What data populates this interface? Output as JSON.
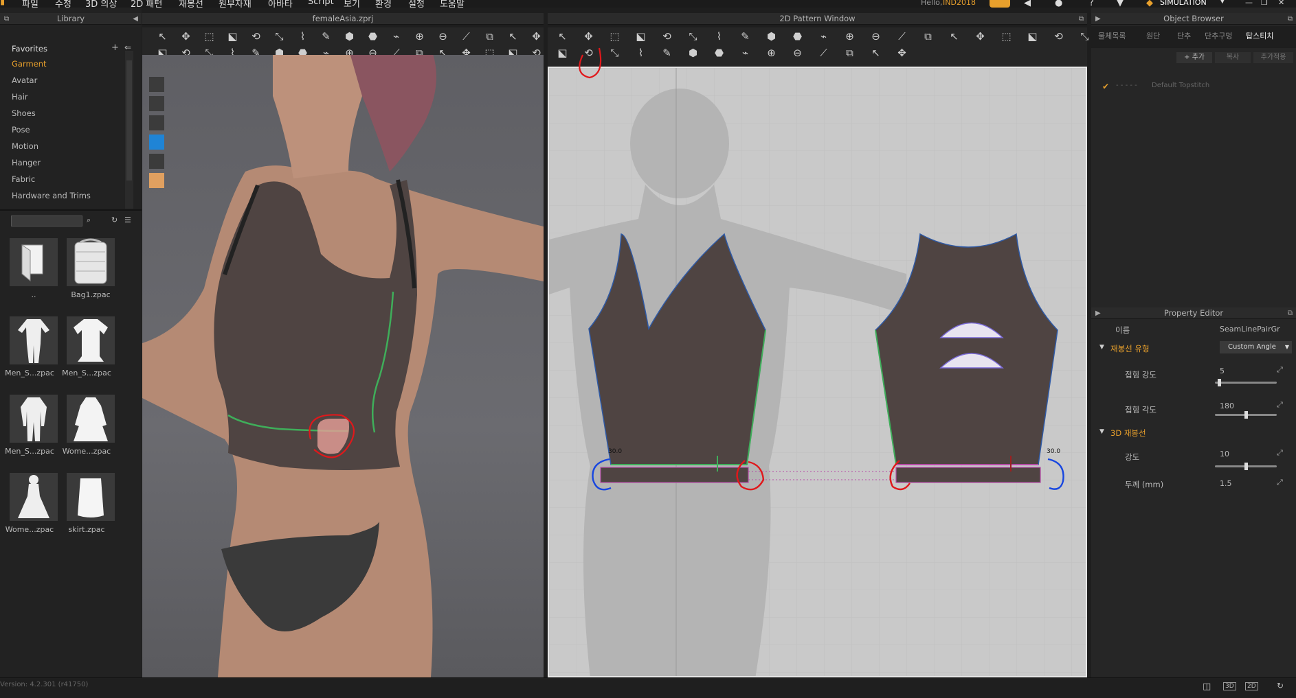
{
  "menu": [
    "파일",
    "수정",
    "3D 의상",
    "2D 패턴",
    "재봉선",
    "원부자재",
    "아바타",
    "Script",
    "보기",
    "환경",
    "설정",
    "도움말"
  ],
  "top_right": {
    "hello": "Hello, ",
    "user": "IND2018",
    "mode": "SIMULATION"
  },
  "library": {
    "title": "Library",
    "favorites_label": "Favorites",
    "items": [
      "Garment",
      "Avatar",
      "Hair",
      "Shoes",
      "Pose",
      "Motion",
      "Hanger",
      "Fabric",
      "Hardware and Trims"
    ],
    "search_placeholder": "",
    "thumbnails": [
      {
        "label": "..",
        "kind": "folder"
      },
      {
        "label": "Bag1.zpac",
        "kind": "bag"
      },
      {
        "label": "Men_S...zpac",
        "kind": "suit"
      },
      {
        "label": "Men_S...zpac",
        "kind": "shirt"
      },
      {
        "label": "Men_S...zpac",
        "kind": "suit2"
      },
      {
        "label": "Wome...zpac",
        "kind": "dress"
      },
      {
        "label": "Wome...zpac",
        "kind": "gown"
      },
      {
        "label": "skirt.zpac",
        "kind": "skirt"
      }
    ]
  },
  "view3d": {
    "title": "femaleAsia.zprj"
  },
  "view2d": {
    "title": "2D Pattern Window",
    "measure_left": "30.0",
    "measure_right": "30.0"
  },
  "object_browser": {
    "title": "Object Browser",
    "tabs": [
      "물체목록",
      "원단",
      "단추",
      "단추구멍",
      "탑스티치"
    ],
    "active_tab": 4,
    "buttons": [
      "+ 추가",
      "복사",
      "추가적용"
    ],
    "topstitch_item": "Default Topstitch"
  },
  "property_editor": {
    "title": "Property Editor",
    "name_label": "이름",
    "name_value": "SeamLinePairGr",
    "section1": "재봉선 유형",
    "section1_value": "Custom Angle",
    "fold_strength_label": "접힘 강도",
    "fold_strength_value": "5",
    "fold_strength_fraction": 0.05,
    "fold_angle_label": "접힘 각도",
    "fold_angle_value": "180",
    "fold_angle_fraction": 0.5,
    "section2": "3D 재봉선",
    "strength_label": "강도",
    "strength_value": "10",
    "strength_fraction": 0.5,
    "thickness_label": "두께 (mm)",
    "thickness_value": "1.5"
  },
  "status": {
    "version": "Version: 4.2.301 (r41750)"
  },
  "colors": {
    "accent": "#e8a02c",
    "seam_green": "#3fae5a",
    "pattern_fill": "#4f4442",
    "annot_red": "#e0181b",
    "annot_blue": "#1746e0"
  }
}
